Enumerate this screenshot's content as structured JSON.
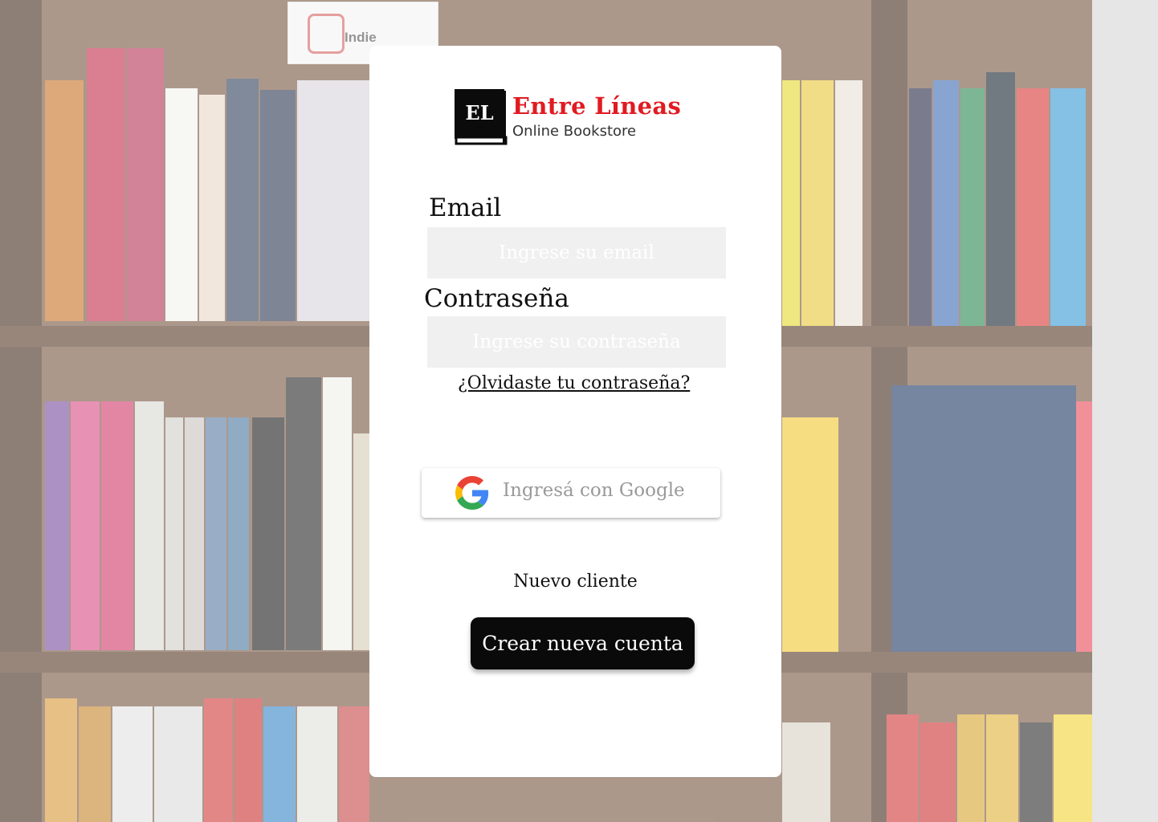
{
  "brand": {
    "logo_initials": "EL",
    "name": "Entre Líneas",
    "tagline": "Online Bookstore",
    "accent_color": "#e01b22"
  },
  "form": {
    "email_label": "Email",
    "email_placeholder": "Ingrese su email",
    "password_label": "Contraseña",
    "password_placeholder": "Ingrese su contraseña",
    "forgot_link": "¿Olvidaste tu contraseña?"
  },
  "google": {
    "label": "Ingresá con Google",
    "icon": "google-icon"
  },
  "signup": {
    "prompt": "Nuevo cliente",
    "button_label": "Crear nueva cuenta"
  },
  "background": {
    "sign_text": "Indie"
  }
}
